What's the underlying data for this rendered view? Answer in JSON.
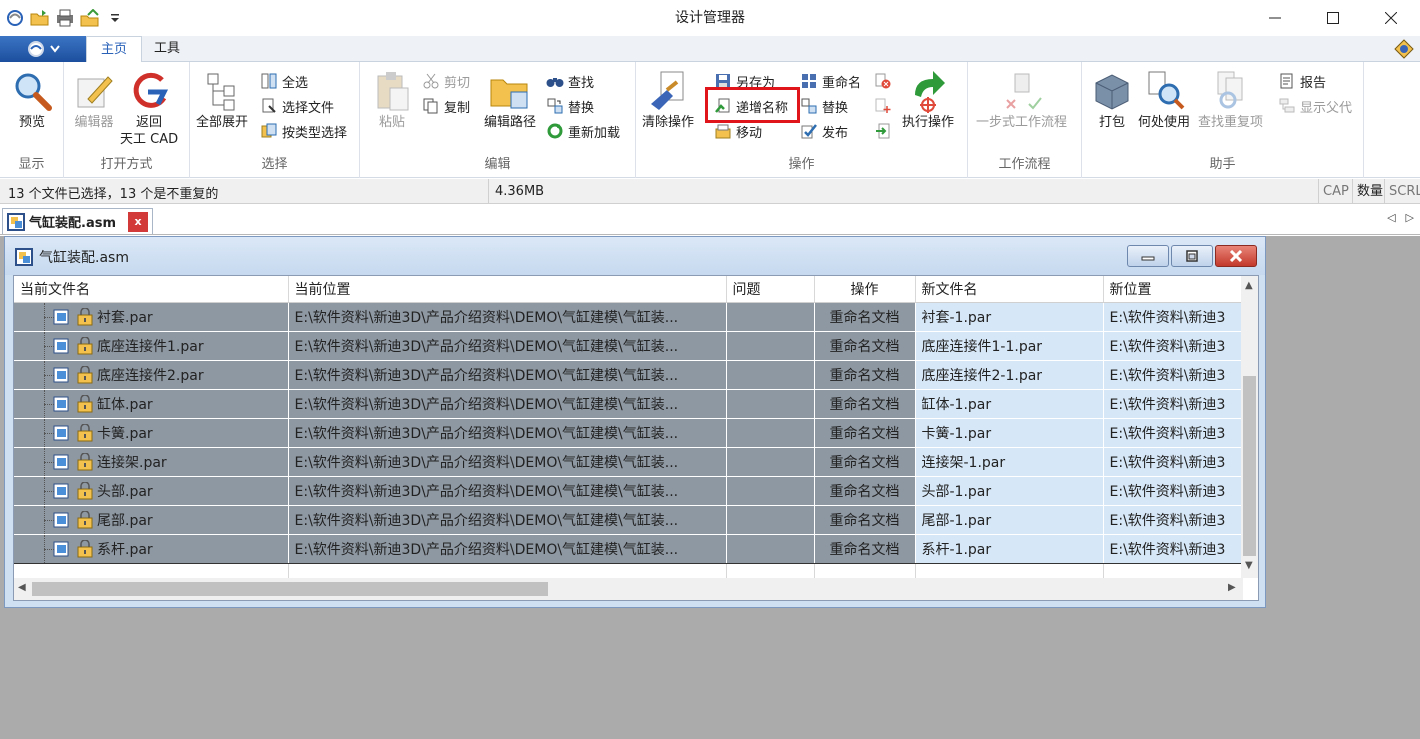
{
  "window": {
    "title": "设计管理器",
    "controls": [
      "minimize",
      "maximize",
      "close"
    ]
  },
  "ribbon_tabs": {
    "home": "主页",
    "tools": "工具"
  },
  "ribbon": {
    "groups": {
      "display": "显示",
      "open_with": "打开方式",
      "select": "选择",
      "edit": "编辑",
      "operations": "操作",
      "workflow": "工作流程",
      "assistant": "助手"
    },
    "buttons": {
      "preview": "预览",
      "editor": "编辑器",
      "back_cad_line1": "返回",
      "back_cad_line2": "天工 CAD",
      "expand_all": "全部展开",
      "select_all": "全选",
      "select_files": "选择文件",
      "select_by_type": "按类型选择",
      "paste": "粘贴",
      "cut": "剪切",
      "copy": "复制",
      "edit_path": "编辑路径",
      "find": "查找",
      "replace_edit": "替换",
      "reload": "重新加载",
      "clear_ops": "清除操作",
      "save_as": "另存为",
      "increment_name": "递增名称",
      "move": "移动",
      "rename": "重命名",
      "replace_op": "替换",
      "publish": "发布",
      "execute": "执行操作",
      "one_step_workflow": "一步式工作流程",
      "pack": "打包",
      "where_used": "何处使用",
      "find_duplicates": "查找重复项",
      "report": "报告",
      "show_parent": "显示父代"
    }
  },
  "status": {
    "selection": "13 个文件已选择，13 个是不重复的",
    "size": "4.36MB",
    "indicators": [
      "CAP",
      "数量",
      "SCRL"
    ]
  },
  "doc_tab": {
    "name": "气缸装配.asm",
    "close": "x"
  },
  "child_window": {
    "title": "气缸装配.asm"
  },
  "table": {
    "columns": [
      "当前文件名",
      "当前位置",
      "问题",
      "操作",
      "新文件名",
      "新位置"
    ],
    "rows": [
      {
        "name": "衬套.par",
        "location": "E:\\软件资料\\新迪3D\\产品介绍资料\\DEMO\\气缸建模\\气缸装...",
        "issue": "",
        "op": "重命名文档",
        "new_name": "衬套-1.par",
        "new_location": "E:\\软件资料\\新迪3"
      },
      {
        "name": "底座连接件1.par",
        "location": "E:\\软件资料\\新迪3D\\产品介绍资料\\DEMO\\气缸建模\\气缸装...",
        "issue": "",
        "op": "重命名文档",
        "new_name": "底座连接件1-1.par",
        "new_location": "E:\\软件资料\\新迪3"
      },
      {
        "name": "底座连接件2.par",
        "location": "E:\\软件资料\\新迪3D\\产品介绍资料\\DEMO\\气缸建模\\气缸装...",
        "issue": "",
        "op": "重命名文档",
        "new_name": "底座连接件2-1.par",
        "new_location": "E:\\软件资料\\新迪3"
      },
      {
        "name": "缸体.par",
        "location": "E:\\软件资料\\新迪3D\\产品介绍资料\\DEMO\\气缸建模\\气缸装...",
        "issue": "",
        "op": "重命名文档",
        "new_name": "缸体-1.par",
        "new_location": "E:\\软件资料\\新迪3"
      },
      {
        "name": "卡簧.par",
        "location": "E:\\软件资料\\新迪3D\\产品介绍资料\\DEMO\\气缸建模\\气缸装...",
        "issue": "",
        "op": "重命名文档",
        "new_name": "卡簧-1.par",
        "new_location": "E:\\软件资料\\新迪3"
      },
      {
        "name": "连接架.par",
        "location": "E:\\软件资料\\新迪3D\\产品介绍资料\\DEMO\\气缸建模\\气缸装...",
        "issue": "",
        "op": "重命名文档",
        "new_name": "连接架-1.par",
        "new_location": "E:\\软件资料\\新迪3"
      },
      {
        "name": "头部.par",
        "location": "E:\\软件资料\\新迪3D\\产品介绍资料\\DEMO\\气缸建模\\气缸装...",
        "issue": "",
        "op": "重命名文档",
        "new_name": "头部-1.par",
        "new_location": "E:\\软件资料\\新迪3"
      },
      {
        "name": "尾部.par",
        "location": "E:\\软件资料\\新迪3D\\产品介绍资料\\DEMO\\气缸建模\\气缸装...",
        "issue": "",
        "op": "重命名文档",
        "new_name": "尾部-1.par",
        "new_location": "E:\\软件资料\\新迪3"
      },
      {
        "name": "系杆.par",
        "location": "E:\\软件资料\\新迪3D\\产品介绍资料\\DEMO\\气缸建模\\气缸装...",
        "issue": "",
        "op": "重命名文档",
        "new_name": "系杆-1.par",
        "new_location": "E:\\软件资料\\新迪3"
      }
    ]
  },
  "colors": {
    "highlight_box": "#e0141b",
    "selected_row": "#8e98a3",
    "new_value_cell": "#d6e7f7",
    "active_tab_text": "#2a62b8"
  }
}
